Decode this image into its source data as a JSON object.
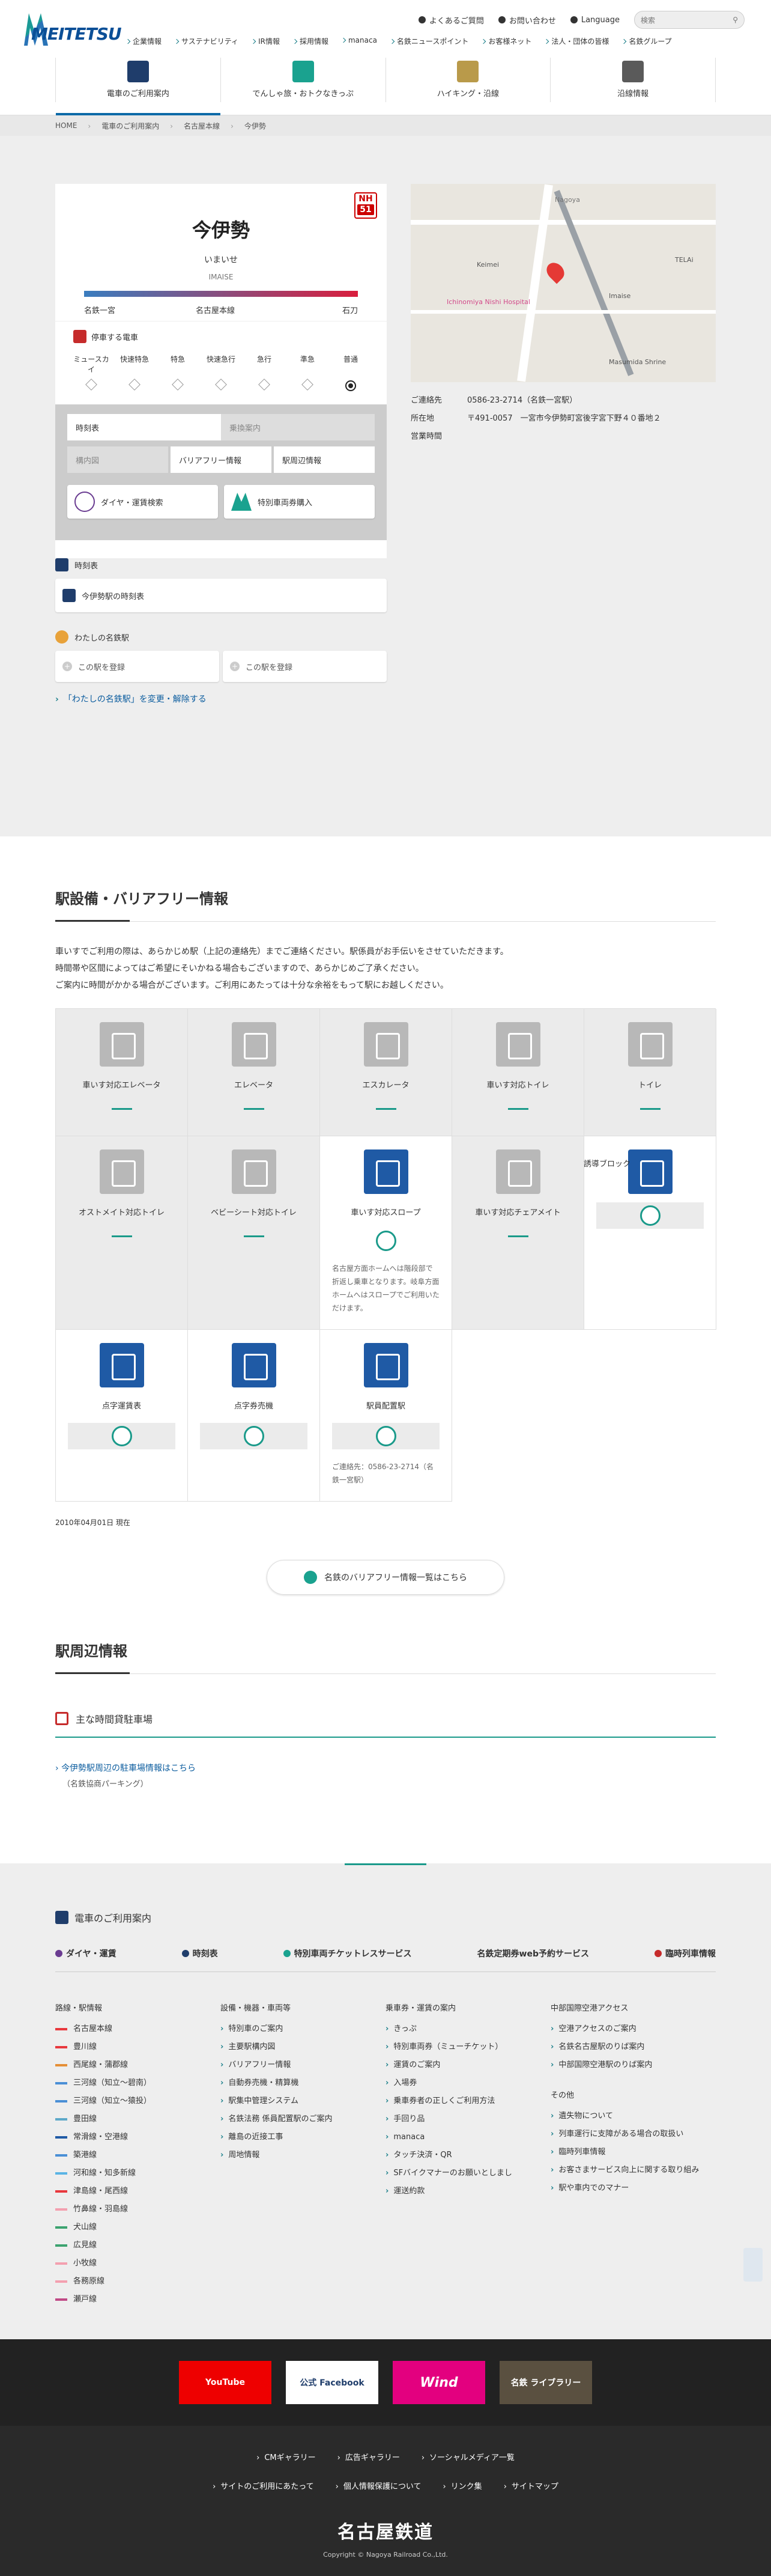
{
  "header": {
    "logo": "MEITETSU",
    "util": [
      "よくあるご質問",
      "お問い合わせ",
      "Language"
    ],
    "search_placeholder": "検索",
    "top_links": [
      "企業情報",
      "サステナビリティ",
      "IR情報",
      "採用情報",
      "manaca",
      "名鉄ニュースポイント",
      "お客様ネット",
      "法人・団体の皆様",
      "名鉄グループ"
    ],
    "main_nav": [
      "電車のご利用案内",
      "でんしゃ旅・おトクなきっぷ",
      "ハイキング・沿線",
      "沿線情報"
    ]
  },
  "breadcrumb": [
    "HOME",
    "電車のご利用案内",
    "名古屋本線",
    "今伊勢"
  ],
  "station": {
    "name": "今伊勢",
    "yomi": "いまいせ",
    "en": "IMAISE",
    "number_line": "NH",
    "number": "51",
    "prev": "名鉄一宮",
    "line": "名古屋本線",
    "next": "石刀",
    "stop_title": "停車する電車",
    "kinds": [
      "ミュースカイ",
      "快速特急",
      "特急",
      "快速急行",
      "急行",
      "準急",
      "普通"
    ],
    "tabs": [
      "時刻表",
      "乗換案内",
      "構内図",
      "バリアフリー情報",
      "駅周辺情報"
    ],
    "btn_dia": "ダイヤ・運賃検索",
    "btn_ticket": "特別車両券購入",
    "timetable_title": "時刻表",
    "timetable_link": "今伊勢駅の時刻表",
    "my_title": "わたしの名鉄駅",
    "my_btn": "この駅を登録",
    "change_link": "「わたしの名鉄駅」を変更・解除する"
  },
  "map": {
    "labels": [
      "Nagoya",
      "Keimei",
      "Ichinomiya Nishi Hospital",
      "Imaise",
      "Masumida Shrine",
      "TELAi"
    ]
  },
  "contact": {
    "k1": "ご連絡先",
    "v1": "0586-23-2714（名鉄一宮駅）",
    "k2": "所在地",
    "v2": "〒491-0057　一宮市今伊勢町宮後字宮下野４０番地２",
    "k3": "営業時間",
    "v3": ""
  },
  "facilities": {
    "title": "駅設備・バリアフリー情報",
    "notes": [
      "車いすでご利用の際は、あらかじめ駅（上記の連絡先）までご連絡ください。駅係員がお手伝いをさせていただきます。",
      "時間帯や区間によってはご希望にそいかねる場合もございますので、あらかじめご了承ください。",
      "ご案内に時間がかかる場合がございます。ご利用にあたっては十分な余裕をもって駅にお越しください。"
    ],
    "items": [
      {
        "label": "車いす対応エレベータ",
        "on": false
      },
      {
        "label": "エレベータ",
        "on": false
      },
      {
        "label": "エスカレータ",
        "on": false
      },
      {
        "label": "車いす対応トイレ",
        "on": false
      },
      {
        "label": "トイレ",
        "on": false
      },
      {
        "label": "オストメイト対応トイレ",
        "on": false
      },
      {
        "label": "ベビーシート対応トイレ",
        "on": false
      },
      {
        "label": "車いす対応スロープ",
        "on": true,
        "note": "名古屋方面ホームへは階段部で折返し乗車となります。岐阜方面ホームへはスロープでご利用いただけます。"
      },
      {
        "label": "車いす対応チェアメイト",
        "on": false
      },
      {
        "label": "誘導ブロック",
        "on": true
      },
      {
        "label": "点字運賃表",
        "on": true
      },
      {
        "label": "点字券売機",
        "on": true
      },
      {
        "label": "駅員配置駅",
        "on": true,
        "note": "ご連絡先：0586-23-2714（名鉄一宮駅）"
      }
    ],
    "date": "2010年04月01日 現在",
    "button": "名鉄のバリアフリー情報一覧はこちら"
  },
  "around": {
    "title": "駅周辺情報",
    "parking_title": "主な時間貸駐車場",
    "parking_link": "今伊勢駅周辺の駐車場情報はこちら",
    "parking_sub": "（名鉄協商パーキング）"
  },
  "footer_nav": {
    "title": "電車のご利用案内",
    "band": [
      "ダイヤ・運賃",
      "時刻表",
      "特別車両チケットレスサービス",
      "名鉄定期券web予約サービス",
      "臨時列車情報"
    ],
    "col1_title": "路線・駅情報",
    "lines": [
      {
        "name": "名古屋本線",
        "color": "#e8383d"
      },
      {
        "name": "豊川線",
        "color": "#e8383d"
      },
      {
        "name": "西尾線・蒲郡線",
        "color": "#e58f36"
      },
      {
        "name": "三河線（知立〜碧南）",
        "color": "#4a8fd6"
      },
      {
        "name": "三河線（知立〜猿投）",
        "color": "#4a8fd6"
      },
      {
        "name": "豊田線",
        "color": "#5da9c9"
      },
      {
        "name": "常滑線・空港線",
        "color": "#1f5aa5"
      },
      {
        "name": "築港線",
        "color": "#4a8fd6"
      },
      {
        "name": "河和線・知多新線",
        "color": "#5ab4e5"
      },
      {
        "name": "津島線・尾西線",
        "color": "#e8383d"
      },
      {
        "name": "竹鼻線・羽島線",
        "color": "#f4a0b0"
      },
      {
        "name": "犬山線",
        "color": "#3ca370"
      },
      {
        "name": "広見線",
        "color": "#3ca370"
      },
      {
        "name": "小牧線",
        "color": "#f4a0b0"
      },
      {
        "name": "各務原線",
        "color": "#f4a0b0"
      },
      {
        "name": "瀬戸線",
        "color": "#c04a86"
      }
    ],
    "col2_title": "設備・機器・車両等",
    "col2": [
      "特別車のご案内",
      "主要駅構内図",
      "バリアフリー情報",
      "自動券売機・精算機",
      "駅集中管理システム",
      "名鉄法務 係員配置駅のご案内",
      "離島の近接工事",
      "周地情報"
    ],
    "col3_title": "乗車券・運賃の案内",
    "col3": [
      "きっぷ",
      "特別車両券（ミューチケット）",
      "運賃のご案内",
      "入場券",
      "乗車券者の正しくご利用方法",
      "手回り品",
      "manaca",
      "タッチ決済・QR",
      "SFバイクマナーのお願いとしまし",
      "運送約款"
    ],
    "col4_title": "中部国際空港アクセス",
    "col4": [
      "空港アクセスのご案内",
      "名鉄名古屋駅のりば案内",
      "中部国際空港駅のりば案内"
    ],
    "col4b_title": "その他",
    "col4b": [
      "遺失物について",
      "列車運行に支障がある場合の取扱い",
      "臨時列車情報",
      "お客さまサービス向上に関する取り組み",
      "駅や車内でのマナー"
    ]
  },
  "sns": [
    "YouTube",
    "公式 Facebook",
    "Wind",
    "名鉄 ライブラリー"
  ],
  "footer": {
    "links1": [
      "CMギャラリー",
      "広告ギャラリー",
      "ソーシャルメディア一覧"
    ],
    "links2": [
      "サイトのご利用にあたって",
      "個人情報保護について",
      "リンク集",
      "サイトマップ"
    ],
    "brand": "名古屋鉄道",
    "copy": "Copyright © Nagoya Railroad Co.,Ltd."
  }
}
